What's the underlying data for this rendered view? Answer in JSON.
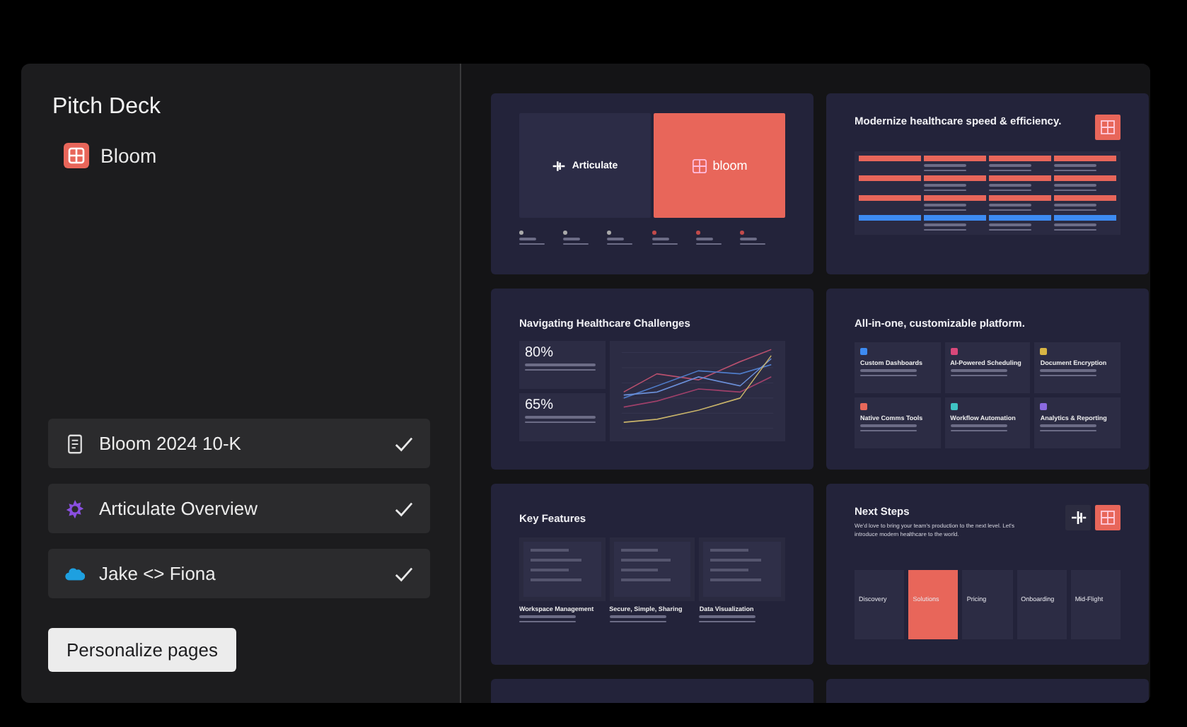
{
  "panel": {
    "title": "Pitch Deck",
    "company": {
      "name": "Bloom"
    }
  },
  "sources": [
    {
      "label": "Bloom 2024 10-K",
      "kind": "document",
      "checked": true
    },
    {
      "label": "Articulate Overview",
      "kind": "burst",
      "checked": true
    },
    {
      "label": "Jake <> Fiona",
      "kind": "cloud",
      "checked": true
    }
  ],
  "button": "Personalize pages",
  "slides": [
    {
      "kind": "cover",
      "left_logo": "Articulate",
      "right_logo": "bloom"
    },
    {
      "kind": "table",
      "title": "Modernize healthcare speed & efficiency."
    },
    {
      "kind": "stats",
      "title": "Navigating Healthcare Challenges",
      "stats": [
        "80%",
        "65%"
      ]
    },
    {
      "kind": "grid",
      "title": "All-in-one, customizable platform.",
      "cards": [
        {
          "label": "Custom Dashboards",
          "color": "#3d8bf2"
        },
        {
          "label": "AI-Powered Scheduling",
          "color": "#d9487a"
        },
        {
          "label": "Document Encryption",
          "color": "#d8b544"
        },
        {
          "label": "Native Comms Tools",
          "color": "#e8685a"
        },
        {
          "label": "Workflow Automation",
          "color": "#3fc4c4"
        },
        {
          "label": "Analytics & Reporting",
          "color": "#8b6ae0"
        }
      ]
    },
    {
      "kind": "features",
      "title": "Key Features",
      "columns": [
        "Workspace Management",
        "Secure, Simple, Sharing",
        "Data Visualization"
      ]
    },
    {
      "kind": "steps",
      "title": "Next Steps",
      "subtitle": "We'd love to bring your team's production to the next level. Let's introduce modern healthcare to the world.",
      "steps": [
        {
          "label": "Discovery",
          "selected": false
        },
        {
          "label": "Solutions",
          "selected": true
        },
        {
          "label": "Pricing",
          "selected": false
        },
        {
          "label": "Onboarding",
          "selected": false
        },
        {
          "label": "Mid-Flight",
          "selected": false
        }
      ]
    },
    {
      "kind": "blank"
    },
    {
      "kind": "blank"
    }
  ]
}
